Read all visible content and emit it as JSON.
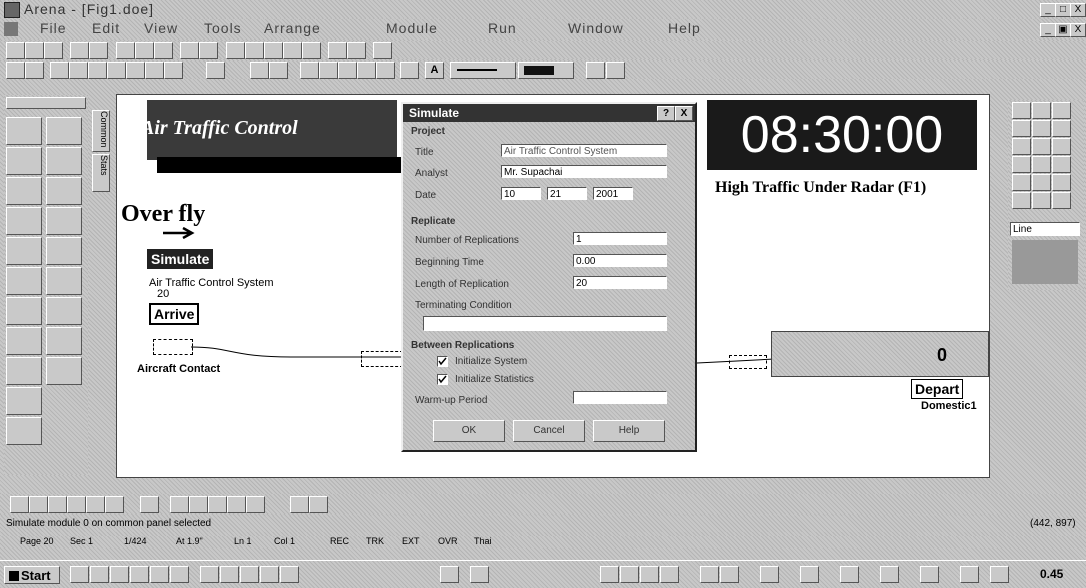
{
  "window": {
    "title": "Arena - [Fig1.doe]",
    "controls": [
      "_",
      "□",
      "X"
    ],
    "mdi_controls": [
      "_",
      "▣",
      "X"
    ]
  },
  "menubar": [
    "File",
    "Edit",
    "View",
    "Tools",
    "Arrange",
    "Module",
    "Run",
    "Window",
    "Help"
  ],
  "left_palette": {
    "tabs": [
      "Common",
      "Stats"
    ]
  },
  "canvas": {
    "banner_title": "Air Traffic Control",
    "clock": "08:30:00",
    "traffic_label": "High Traffic Under Radar (F1)",
    "overfly_label": "Over fly",
    "simulate_label": "Simulate",
    "system_label": "Air Traffic Control System",
    "system_value": "20",
    "arrive_label": "Arrive",
    "contact_label": "Aircraft Contact",
    "route_count": "0",
    "depart_label": "Depart",
    "domestic_label": "Domestic1"
  },
  "dialog": {
    "title": "Simulate",
    "help_btn": "?",
    "close_btn": "X",
    "project_group": "Project",
    "title_label": "Title",
    "title_value": "Air Traffic Control System",
    "analyst_label": "Analyst",
    "analyst_value": "Mr. Supachai",
    "date_label": "Date",
    "date_month": "10",
    "date_day": "21",
    "date_year": "2001",
    "replicate_group": "Replicate",
    "num_reps_label": "Number of Replications",
    "num_reps_value": "1",
    "begin_label": "Beginning Time",
    "begin_value": "0.00",
    "length_label": "Length of Replication",
    "length_value": "20",
    "terminating_label": "Terminating Condition",
    "terminating_value": "",
    "between_group": "Between Replications",
    "init_system_label": "Initialize System",
    "init_system_checked": true,
    "init_stats_label": "Initialize Statistics",
    "init_stats_checked": true,
    "warmup_label": "Warm-up Period",
    "warmup_value": "",
    "ok_label": "OK",
    "cancel_label": "Cancel",
    "help_label": "Help"
  },
  "right_palette": {
    "line_select": "Line"
  },
  "status_bar": {
    "message": "Simulate module 0 on common panel selected",
    "coords": "(442, 897)"
  },
  "status_bar2": {
    "fields": [
      "Page 20",
      "Sec 1",
      "1/424",
      "At 1.9\"",
      "Ln 1",
      "Col 1",
      "REC",
      "TRK",
      "EXT",
      "OVR",
      "Thai"
    ]
  },
  "taskbar": {
    "start_label": "Start",
    "time": "0.45"
  }
}
